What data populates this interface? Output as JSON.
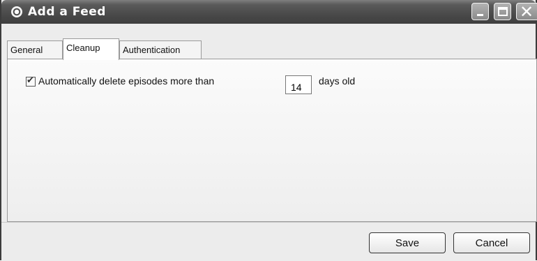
{
  "window": {
    "title": "Add a Feed",
    "controls": {
      "minimize": "minimize",
      "maximize": "maximize",
      "close": "close"
    }
  },
  "tabs": [
    {
      "label": "General",
      "active": false
    },
    {
      "label": "Cleanup",
      "active": true
    },
    {
      "label": "Authentication",
      "active": false
    }
  ],
  "cleanup": {
    "auto_delete_label": "Automatically delete episodes more than",
    "auto_delete_checked": true,
    "days_value": "14",
    "days_suffix": "days old"
  },
  "buttons": {
    "save": "Save",
    "cancel": "Cancel"
  },
  "icons": {
    "title": "app-radio-icon",
    "checkmark": "checkmark-icon"
  }
}
